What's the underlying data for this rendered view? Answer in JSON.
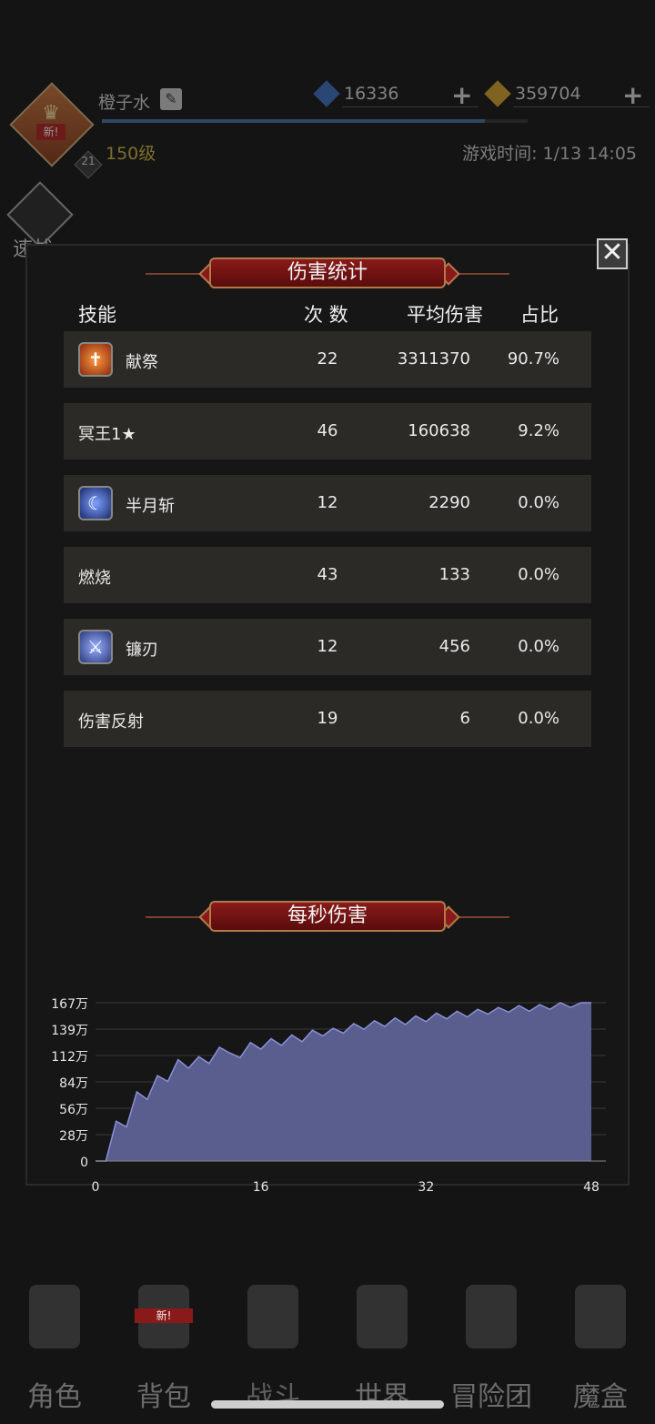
{
  "header": {
    "username": "橙子水",
    "level": "150级",
    "badge_number": "21",
    "avatar_tag": "新!",
    "gems": "16336",
    "gold": "359704",
    "game_time": "游戏时间: 1/13 14:05",
    "quick_battle": "速战"
  },
  "modal": {
    "title": "伤害统计",
    "columns": [
      "技能",
      "次 数",
      "平均伤害",
      "占比"
    ],
    "rows": [
      {
        "icon": "sacrifice-icon",
        "name": "献祭",
        "count": "22",
        "avg": "3311370",
        "pct": "90.7%"
      },
      {
        "icon": "",
        "name": "冥王1★",
        "count": "46",
        "avg": "160638",
        "pct": "9.2%"
      },
      {
        "icon": "crescent-slash-icon",
        "name": "半月斩",
        "count": "12",
        "avg": "2290",
        "pct": "0.0%"
      },
      {
        "icon": "",
        "name": "燃烧",
        "count": "43",
        "avg": "133",
        "pct": "0.0%"
      },
      {
        "icon": "sickle-blade-icon",
        "name": "镰刃",
        "count": "12",
        "avg": "456",
        "pct": "0.0%"
      },
      {
        "icon": "",
        "name": "伤害反射",
        "count": "19",
        "avg": "6",
        "pct": "0.0%"
      }
    ],
    "dps_title": "每秒伤害"
  },
  "chart_data": {
    "type": "area",
    "title": "每秒伤害",
    "x_ticks": [
      "0",
      "16",
      "32",
      "48"
    ],
    "y_ticks": [
      "0",
      "28万",
      "56万",
      "84万",
      "112万",
      "139万",
      "167万"
    ],
    "xlim": [
      0,
      48
    ],
    "ylim": [
      0,
      167
    ],
    "y_unit": "万",
    "grid": true,
    "fill_color": "#5a5e8e",
    "line_color": "#8a90d8",
    "x": [
      0,
      1,
      2,
      3,
      4,
      5,
      6,
      7,
      8,
      9,
      10,
      11,
      12,
      13,
      14,
      15,
      16,
      17,
      18,
      19,
      20,
      21,
      22,
      23,
      24,
      25,
      26,
      27,
      28,
      29,
      30,
      31,
      32,
      33,
      34,
      35,
      36,
      37,
      38,
      39,
      40,
      41,
      42,
      43,
      44,
      45,
      46,
      47,
      48
    ],
    "y": [
      0,
      0,
      42,
      36,
      73,
      65,
      90,
      84,
      107,
      98,
      110,
      103,
      120,
      114,
      109,
      125,
      118,
      129,
      122,
      133,
      126,
      138,
      132,
      140,
      135,
      145,
      139,
      148,
      142,
      151,
      144,
      153,
      147,
      156,
      150,
      158,
      152,
      160,
      155,
      162,
      157,
      164,
      158,
      165,
      160,
      167,
      162,
      167,
      167
    ]
  },
  "nav": [
    {
      "label": "角色",
      "icon": "helmet-icon",
      "active": false
    },
    {
      "label": "背包",
      "icon": "backpack-icon",
      "active": false,
      "tag": "新!"
    },
    {
      "label": "战斗",
      "icon": "shield-sword-icon",
      "active": true
    },
    {
      "label": "世界",
      "icon": "map-scroll-icon",
      "active": false
    },
    {
      "label": "冒险团",
      "icon": "castle-icon",
      "active": false
    },
    {
      "label": "魔盒",
      "icon": "cube-icon",
      "active": false
    }
  ],
  "colors": {
    "row_bg": "#2b2a27",
    "banner_red": "#8a1a1a",
    "level_gold": "#d6b843"
  }
}
